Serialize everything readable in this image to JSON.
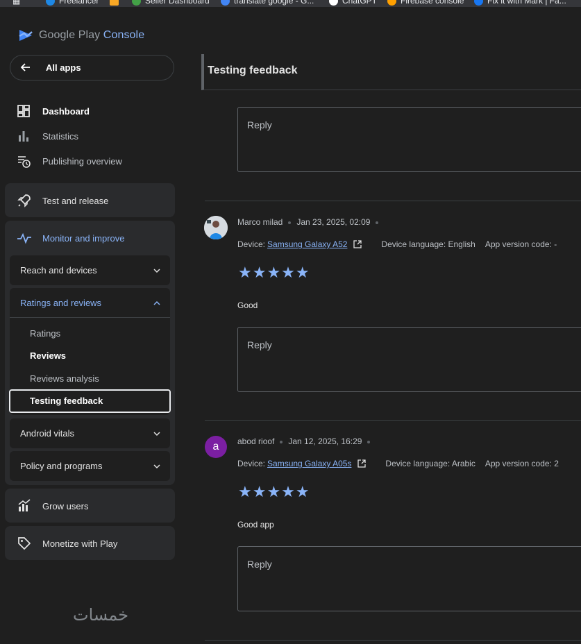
{
  "bookmarks": [
    {
      "label": "Freelancer",
      "color": "#1e88e5"
    },
    {
      "label": "",
      "color": "#f9a825"
    },
    {
      "label": "Seller Dashboard",
      "color": "#43a047"
    },
    {
      "label": "translate google - G...",
      "color": "#4285f4"
    },
    {
      "label": "ChatGPT",
      "color": "#ffffff"
    },
    {
      "label": "Firebase console",
      "color": "#ffa000"
    },
    {
      "label": "Fix it with Mark | Fa...",
      "color": "#1877f2"
    }
  ],
  "logo": {
    "google": "Google Play",
    "console": " Console"
  },
  "sidebar": {
    "all_apps": "All apps",
    "top_items": [
      {
        "label": "Dashboard",
        "icon": "dashboard-icon"
      },
      {
        "label": "Statistics",
        "icon": "bar-chart-icon"
      },
      {
        "label": "Publishing overview",
        "icon": "publishing-icon"
      }
    ],
    "test_release": "Test and release",
    "monitor": "Monitor and improve",
    "reach": "Reach and devices",
    "ratings": "Ratings and reviews",
    "ratings_sub": [
      "Ratings",
      "Reviews",
      "Reviews analysis",
      "Testing feedback"
    ],
    "vitals": "Android vitals",
    "policy": "Policy and programs",
    "grow": "Grow users",
    "monetize": "Monetize with Play"
  },
  "main": {
    "title": "Testing feedback",
    "reply_placeholder": "Reply",
    "reviews": [
      {
        "author": "Marco milad",
        "date": "Jan 23, 2025, 02:09",
        "device_label": "Device:",
        "device": "Samsung Galaxy A52",
        "language": "Device language: English",
        "version": "App version code: -",
        "stars": "★★★★★",
        "text": "Good",
        "avatar_type": "photo"
      },
      {
        "author": "abod rioof",
        "date": "Jan 12, 2025, 16:29",
        "device_label": "Device:",
        "device": "Samsung Galaxy A05s",
        "language": "Device language: Arabic",
        "version": "App version code: 2",
        "stars": "★★★★★",
        "text": "Good app",
        "avatar_letter": "a",
        "avatar_color": "#7b1fa2"
      }
    ]
  },
  "watermark": "خمسات",
  "colors": {
    "accent": "#8ab4f8",
    "background": "#1f1f1f",
    "card": "#2a2b2d"
  }
}
